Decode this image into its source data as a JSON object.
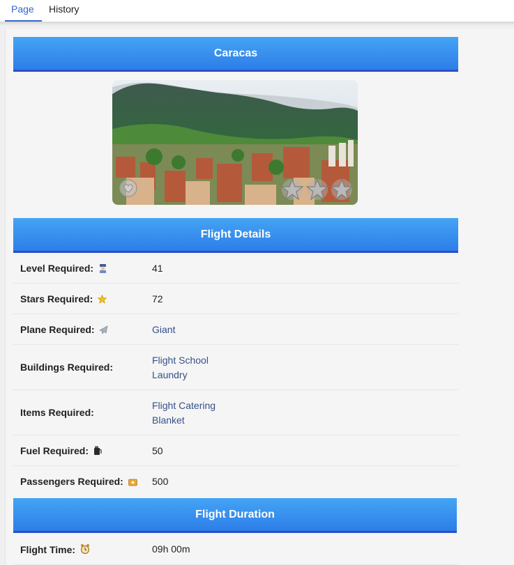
{
  "tabs": [
    {
      "label": "Page",
      "active": true
    },
    {
      "label": "History",
      "active": false
    }
  ],
  "city": {
    "name": "Caracas",
    "stars_filled": 0,
    "stars_total": 3,
    "favorite": false
  },
  "flight_details": {
    "title": "Flight Details",
    "rows": {
      "level": {
        "label": "Level Required:",
        "icon": "pilot-icon",
        "value": "41"
      },
      "stars": {
        "label": "Stars Required:",
        "icon": "star-icon",
        "value": "72"
      },
      "plane": {
        "label": "Plane Required:",
        "icon": "plane-icon",
        "value": "Giant"
      },
      "buildings": {
        "label": "Buildings Required:",
        "values": [
          "Flight School",
          "Laundry"
        ]
      },
      "items": {
        "label": "Items Required:",
        "values": [
          "Flight Catering",
          "Blanket"
        ]
      },
      "fuel": {
        "label": "Fuel Required:",
        "icon": "fuel-icon",
        "value": "50"
      },
      "passengers": {
        "label": "Passengers Required:",
        "icon": "ticket-icon",
        "value": "500"
      }
    }
  },
  "flight_duration": {
    "title": "Flight Duration",
    "time": {
      "label": "Flight Time:",
      "icon": "alarm-clock-icon",
      "value": "09h 00m"
    }
  },
  "colors": {
    "header_top": "#44a4f4",
    "header_bottom": "#2d7ee8",
    "header_border": "#2b4fc7",
    "link": "#36508a",
    "tab_active": "#3366cc"
  }
}
